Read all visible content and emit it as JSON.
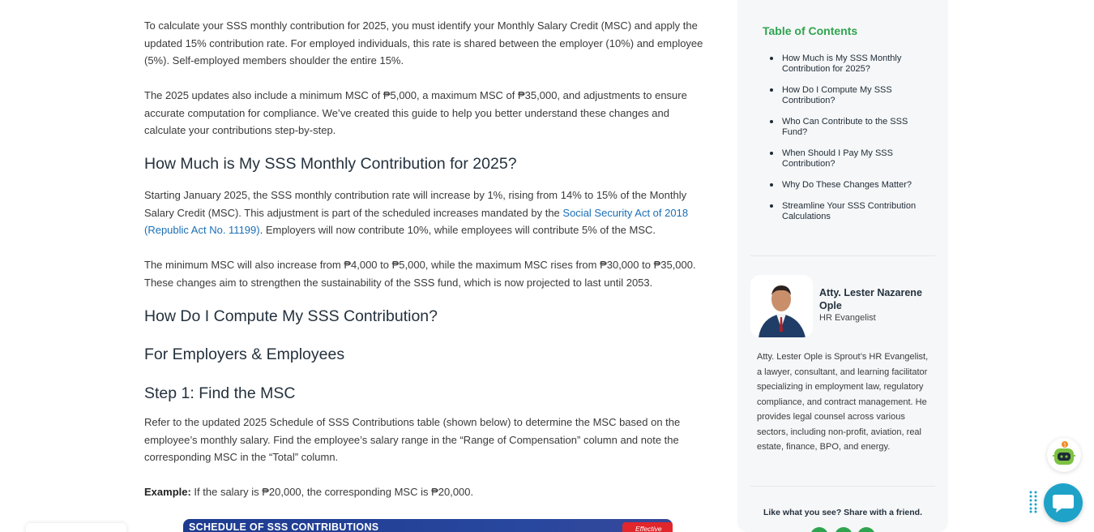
{
  "article": {
    "para1": "To calculate your SSS monthly contribution for 2025, you must identify your Monthly Salary Credit (MSC) and apply the updated 15% contribution rate. For employed individuals, this rate is shared between the employer (10%) and employee (5%). Self-employed members shoulder the entire 15%.",
    "para2": "The 2025 updates also include a minimum MSC of ₱5,000, a maximum MSC of ₱35,000, and adjustments to ensure accurate computation for compliance. We’ve created this guide to help you better understand these changes and calculate your contributions step-by-step.",
    "heading1": "How Much is My SSS Monthly Contribution for 2025?",
    "para3_before": "Starting January 2025, the SSS monthly contribution rate will increase by 1%, rising from 14% to 15% of the Monthly Salary Credit (MSC). This adjustment is part of the scheduled increases mandated by the ",
    "para3_link": "Social Security Act of 2018 (Republic Act No. 11199)",
    "para3_after": ". Employers will now contribute 10%, while employees will contribute 5% of the MSC.",
    "para4": "The minimum MSC will also increase from ₱4,000 to ₱5,000, while the maximum MSC rises from ₱30,000 to ₱35,000. These changes aim to strengthen the sustainability of the SSS fund, which is now projected to last until 2053.",
    "heading2": "How Do I Compute My SSS Contribution?",
    "heading3": "For Employers & Employees",
    "heading4": "Step 1: Find the MSC",
    "para5": "Refer to the updated 2025 Schedule of SSS Contributions table (shown below) to determine the MSC based on the employee’s monthly salary. Find the employee’s salary range in the “Range of Compensation” column and note the corresponding MSC in the “Total” column.",
    "example_label": "Example:",
    "example_text": " If the salary is ₱20,000, the corresponding MSC is ₱20,000.",
    "banner_title": "SCHEDULE OF SSS CONTRIBUTIONS",
    "banner_tag": "Effective"
  },
  "sidebar": {
    "toc_title": "Table of Contents",
    "toc_items": [
      "How Much is My SSS Monthly Contribution for 2025?",
      "How Do I Compute My SSS Contribution?",
      "Who Can Contribute to the SSS Fund?",
      "When Should I Pay My SSS Contribution?",
      "Why Do These Changes Matter?",
      "Streamline Your SSS Contribution Calculations"
    ],
    "author_name": "Atty. Lester Nazarene Ople",
    "author_role": "HR Evangelist",
    "author_bio": "Atty. Lester Ople is Sprout’s HR Evangelist, a lawyer, consultant, and learning facilitator specializing in employment law, regulatory compliance, and contract management. He provides legal counsel across various sectors, including non-profit, aviation, real estate, finance, BPO, and energy.",
    "share_text": "Like what you see? Share with a friend."
  },
  "colors": {
    "toc_title": "#2fa44f",
    "link": "#1a6fb6",
    "chat_button": "#1ea2c8",
    "banner": "#1d3b8f",
    "banner_tag": "#e1262c"
  }
}
